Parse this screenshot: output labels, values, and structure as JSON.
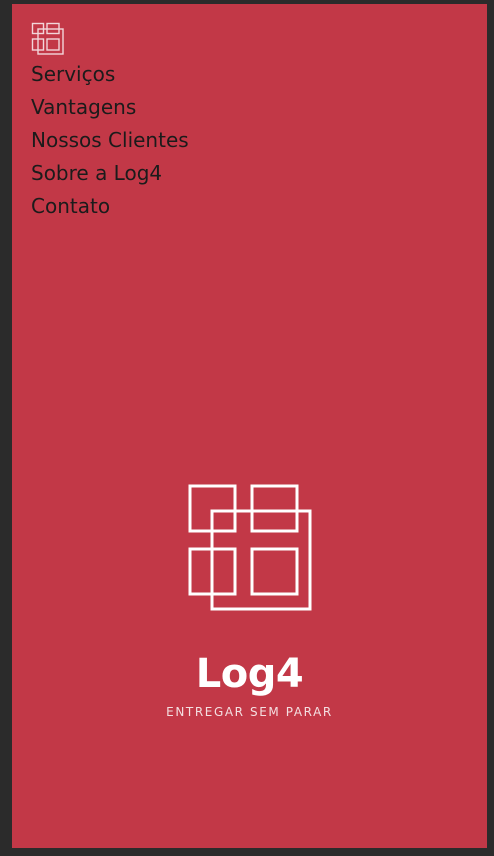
{
  "colors": {
    "background": "#c23847",
    "outer": "#2b2b2b",
    "nav_text": "#1b1b1b",
    "brand_text": "#ffffff"
  },
  "header": {
    "logo_icon": "log4-grid-icon"
  },
  "nav": {
    "items": [
      {
        "label": "Serviços"
      },
      {
        "label": "Vantagens"
      },
      {
        "label": "Nossos Clientes"
      },
      {
        "label": "Sobre a Log4"
      },
      {
        "label": "Contato"
      }
    ]
  },
  "hero": {
    "logo_icon": "log4-grid-icon",
    "brand_name": "Log4",
    "tagline": "ENTREGAR SEM PARAR"
  }
}
